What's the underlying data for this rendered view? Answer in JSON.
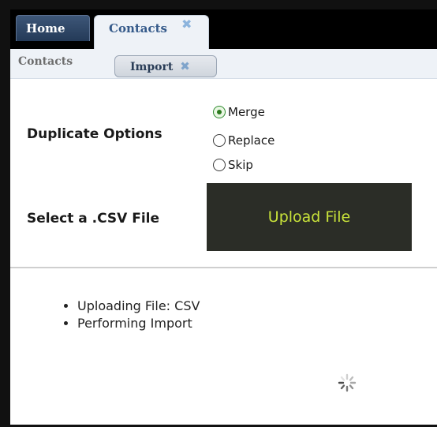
{
  "tabs": {
    "home_label": "Home",
    "contacts_label": "Contacts",
    "close_glyph": "✖"
  },
  "subnav": {
    "contacts_label": "Contacts",
    "import_label": "Import",
    "close_glyph": "✖"
  },
  "form": {
    "duplicate_label": "Duplicate Options",
    "options": [
      "Merge",
      "Replace",
      "Skip"
    ],
    "selected_option": "Merge",
    "file_label": "Select a .CSV File",
    "upload_label": "Upload File"
  },
  "status": {
    "items": [
      "Uploading File: CSV",
      "Performing Import"
    ]
  },
  "icons": {
    "spinner": "loading-spinner-icon",
    "radio_checked": "radio-checked-icon",
    "radio_unchecked": "radio-unchecked-icon"
  },
  "colors": {
    "tab_active_text": "#355a8a",
    "home_tab_bg": "#2f4868",
    "upload_bg": "#2b2d27",
    "upload_text": "#c8e23a",
    "radio_checked": "#2c7a1f"
  }
}
